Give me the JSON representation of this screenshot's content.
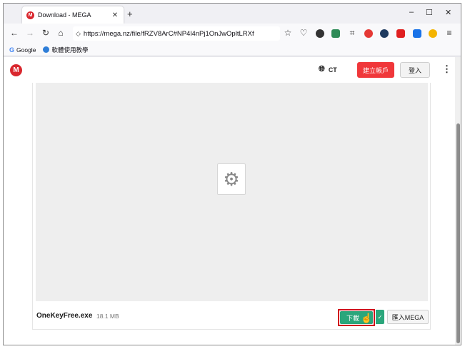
{
  "browser": {
    "tab": {
      "favicon": "M",
      "title": "Download - MEGA",
      "close": "✕"
    },
    "new_tab": "+",
    "window_controls": {
      "minimize": "–",
      "maximize": "☐",
      "close": "✕"
    },
    "nav": {
      "back": "←",
      "forward": "→",
      "reload": "↻",
      "home": "⌂",
      "shield": "◇"
    },
    "url": "https://mega.nz/file/fRZV8ArC#NP4l4nPj1OnJwOpltLRXf",
    "bookmarks": [
      {
        "label": "Google"
      },
      {
        "label": "軟體使用教學"
      }
    ]
  },
  "mega": {
    "logo": "M",
    "language": "CT",
    "create_account": "建立帳戶",
    "login": "登入",
    "menu": "⋮",
    "file": {
      "name": "OneKeyFree.exe",
      "size": "18.1 MB"
    },
    "download_button": "下載",
    "import_button": "匯入MEGA"
  }
}
